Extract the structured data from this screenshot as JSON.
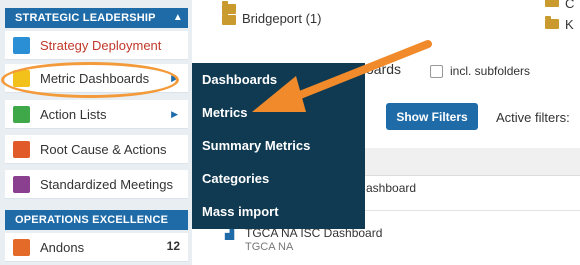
{
  "sidebar": {
    "sections": [
      {
        "title": "STRATEGIC LEADERSHIP",
        "items": [
          {
            "label": "Strategy Deployment",
            "icon": "target-icon",
            "color": "#2b8fd6"
          },
          {
            "label": "Metric Dashboards",
            "icon": "chart-icon",
            "color": "#f2c21a",
            "active": true
          },
          {
            "label": "Action Lists",
            "icon": "checklist-icon",
            "color": "#3fa848"
          },
          {
            "label": "Root Cause & Actions",
            "icon": "warning-icon",
            "color": "#e05a2a"
          },
          {
            "label": "Standardized Meetings",
            "icon": "people-icon",
            "color": "#8a3f8f"
          }
        ]
      },
      {
        "title": "OPERATIONS EXCELLENCE",
        "items": [
          {
            "label": "Andons",
            "icon": "andon-icon",
            "color": "#e46a2a",
            "badge": "12"
          }
        ]
      }
    ]
  },
  "flyout": {
    "items": [
      "Dashboards",
      "Metrics",
      "Summary Metrics",
      "Categories",
      "Mass import"
    ]
  },
  "main": {
    "folders": [
      {
        "label": "Bridgeport (1)"
      }
    ],
    "right_folders": [
      "C",
      "K"
    ],
    "header_partial": "oards",
    "subfolders_label": "incl. subfolders",
    "show_filters_label": "Show Filters",
    "active_filters_label": "Active filters:",
    "rows": [
      {
        "title": "ashboard",
        "subtitle": ""
      },
      {
        "title": "TGCA NA ISC Dashboard",
        "subtitle": "TGCA NA"
      }
    ]
  },
  "colors": {
    "accent": "#1e6ba8",
    "flyout_bg": "#103a52",
    "highlight": "#f39a3a"
  }
}
